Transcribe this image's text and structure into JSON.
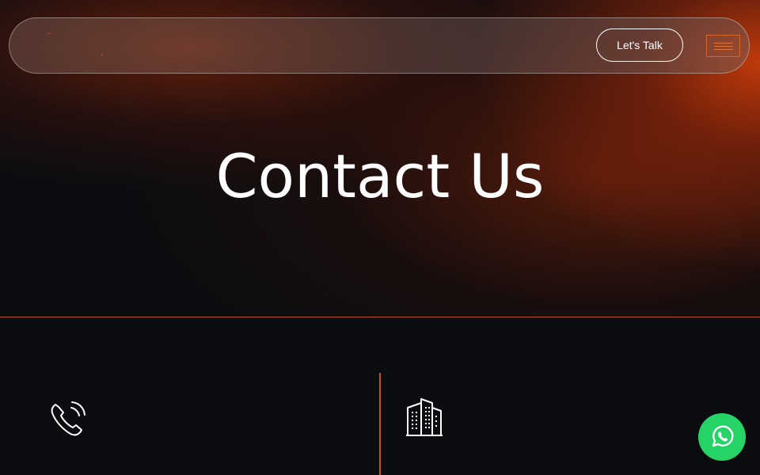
{
  "header": {
    "cta_label": "Let's Talk",
    "menu_icon": "hamburger-menu-icon",
    "logo_icon": "brand-logo"
  },
  "hero": {
    "title": "Contact Us"
  },
  "contact": {
    "items": [
      {
        "icon": "phone-icon"
      },
      {
        "icon": "building-icon"
      }
    ]
  },
  "floating": {
    "whatsapp_icon": "whatsapp-icon"
  },
  "colors": {
    "accent": "#d8642c",
    "background": "#0c0d10",
    "whatsapp": "#25d366",
    "text": "#ffffff"
  }
}
